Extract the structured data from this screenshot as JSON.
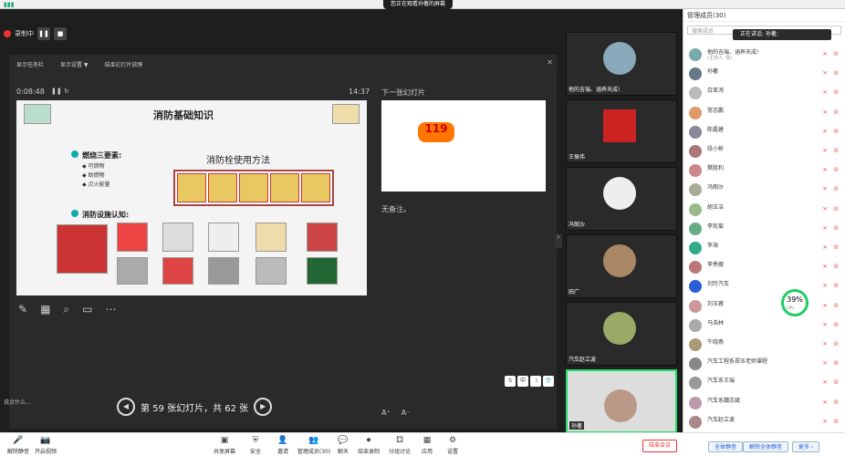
{
  "top": {
    "share_banner": "您正在观看孙著的屏幕"
  },
  "recording": {
    "label": "录制中"
  },
  "ppt": {
    "toolbar": [
      "显示任务栏",
      "显示设置 ▼",
      "结束幻灯片放映"
    ],
    "timer": "0:08:48",
    "clock": "14:37",
    "next_label": "下一张幻灯片",
    "notes": "无备注。",
    "slide": {
      "title": "消防基础知识",
      "heading1": "燃烧三要素:",
      "bullets": [
        "◆ 可燃物",
        "◆ 助燃物",
        "◆ 点火能量"
      ],
      "heading2": "消防设施认知:",
      "heading3": "消防栓使用方法"
    },
    "next_badge": "119",
    "zoom": [
      "A⁺",
      "A⁻"
    ],
    "lang": [
      "S",
      "中",
      "☽",
      "👕"
    ]
  },
  "page_nav": {
    "text": "第 59 张幻灯片，共 62 张"
  },
  "chat_hint": "说点什么...",
  "videos": [
    {
      "name": "他的吉瑞、涵养天成!"
    },
    {
      "name": "王振伟"
    },
    {
      "name": "冯朗沙"
    },
    {
      "name": "田广"
    },
    {
      "name": "汽车赵立波"
    },
    {
      "name": "孙著"
    }
  ],
  "panel": {
    "title": "管理成员(30)",
    "search": "搜索成员",
    "speaking": "正在讲话: 孙著;",
    "members": [
      {
        "name": "他的吉瑞、涵养天成!",
        "sub": "(主持人, 我)"
      },
      {
        "name": "孙著",
        "sub": ""
      },
      {
        "name": "白亚鸿",
        "sub": ""
      },
      {
        "name": "常志鹏",
        "sub": ""
      },
      {
        "name": "陈磊建",
        "sub": ""
      },
      {
        "name": "段小彬",
        "sub": ""
      },
      {
        "name": "樊胜利",
        "sub": ""
      },
      {
        "name": "冯朗沙",
        "sub": ""
      },
      {
        "name": "胡玉洁",
        "sub": ""
      },
      {
        "name": "李宪菊",
        "sub": ""
      },
      {
        "name": "李海",
        "sub": ""
      },
      {
        "name": "李秀娜",
        "sub": ""
      },
      {
        "name": "刘玲汽车",
        "sub": ""
      },
      {
        "name": "刘玉蓉",
        "sub": ""
      },
      {
        "name": "马浩林",
        "sub": ""
      },
      {
        "name": "牛晓燕",
        "sub": ""
      },
      {
        "name": "汽车工程系郑玉老师课程",
        "sub": ""
      },
      {
        "name": "汽车系王瑞",
        "sub": ""
      },
      {
        "name": "汽车系魏志斌",
        "sub": ""
      },
      {
        "name": "汽车赵立波",
        "sub": ""
      }
    ],
    "stat_value": "39%",
    "stat_sub": "CPU"
  },
  "bottom": {
    "items": [
      "解除静音",
      "开启视频",
      "共享屏幕",
      "安全",
      "邀请",
      "管理成员(30)",
      "聊天",
      "结束录制",
      "分组讨论",
      "应用",
      "设置"
    ],
    "end_meeting": "结束会议",
    "mute_all": "全体静音",
    "unmute_all": "解除全体静音",
    "more": "更多 ›"
  },
  "colors": {
    "accent": "#2a5fd6",
    "record": "#e33",
    "active_tile": "#2d6"
  }
}
